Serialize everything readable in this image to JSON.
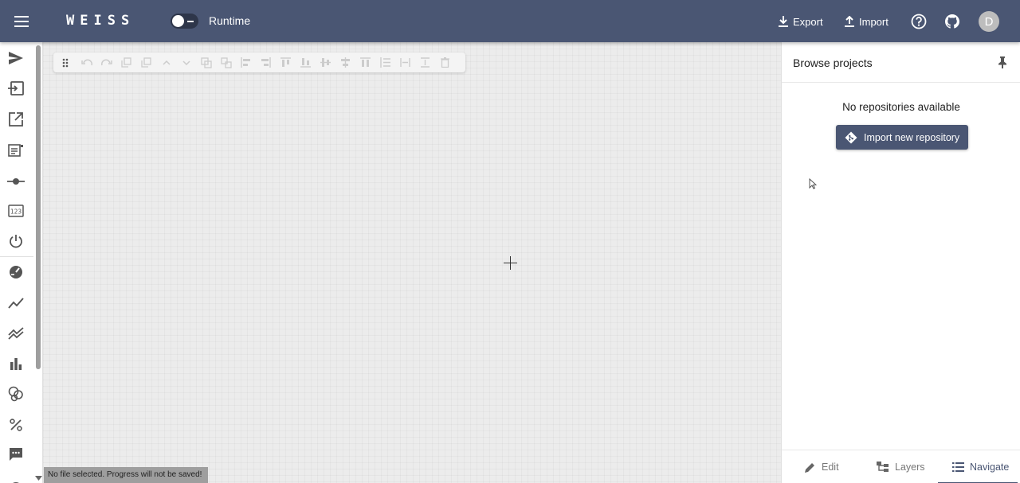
{
  "header": {
    "logo": "WEISS",
    "runtime_label": "Runtime",
    "export_label": "Export",
    "import_label": "Import",
    "avatar_initial": "D"
  },
  "colors": {
    "primary": "#4a5673",
    "canvas_bg": "#ececec",
    "status_bar_bg": "#9e9e9e"
  },
  "sidebar": {
    "items": [
      {
        "icon": "send-icon"
      },
      {
        "icon": "input-icon"
      },
      {
        "icon": "open-in-new-icon"
      },
      {
        "icon": "form-icon"
      },
      {
        "icon": "slider-icon"
      },
      {
        "icon": "numeric-input-icon"
      },
      {
        "icon": "power-icon"
      },
      {
        "icon": "gauge-icon"
      },
      {
        "icon": "line-chart-icon"
      },
      {
        "icon": "multi-line-chart-icon"
      },
      {
        "icon": "bar-chart-icon"
      },
      {
        "icon": "bubbles-icon"
      },
      {
        "icon": "percent-icon"
      },
      {
        "icon": "message-icon"
      }
    ]
  },
  "toolbar": {
    "buttons": [
      "drag-handle-icon",
      "undo-icon",
      "redo-icon",
      "copy-icon",
      "paste-icon",
      "chevron-up-icon",
      "chevron-down-icon",
      "group-icon",
      "ungroup-icon",
      "align-left-icon",
      "align-right-icon",
      "align-top-icon",
      "align-bottom-icon",
      "align-center-horizontal-icon",
      "align-center-vertical-icon",
      "distribute-horizontal-icon",
      "distribute-vertical-icon",
      "expand-width-icon",
      "expand-height-icon",
      "delete-icon"
    ]
  },
  "canvas": {
    "status_text": "No file selected. Progress will not be saved!"
  },
  "right_panel": {
    "title": "Browse projects",
    "empty_text": "No repositories available",
    "import_repo_label": "Import new repository",
    "tabs": [
      {
        "label": "Edit",
        "icon": "pencil-icon",
        "active": false
      },
      {
        "label": "Layers",
        "icon": "layers-tree-icon",
        "active": false
      },
      {
        "label": "Navigate",
        "icon": "list-icon",
        "active": true
      }
    ]
  }
}
